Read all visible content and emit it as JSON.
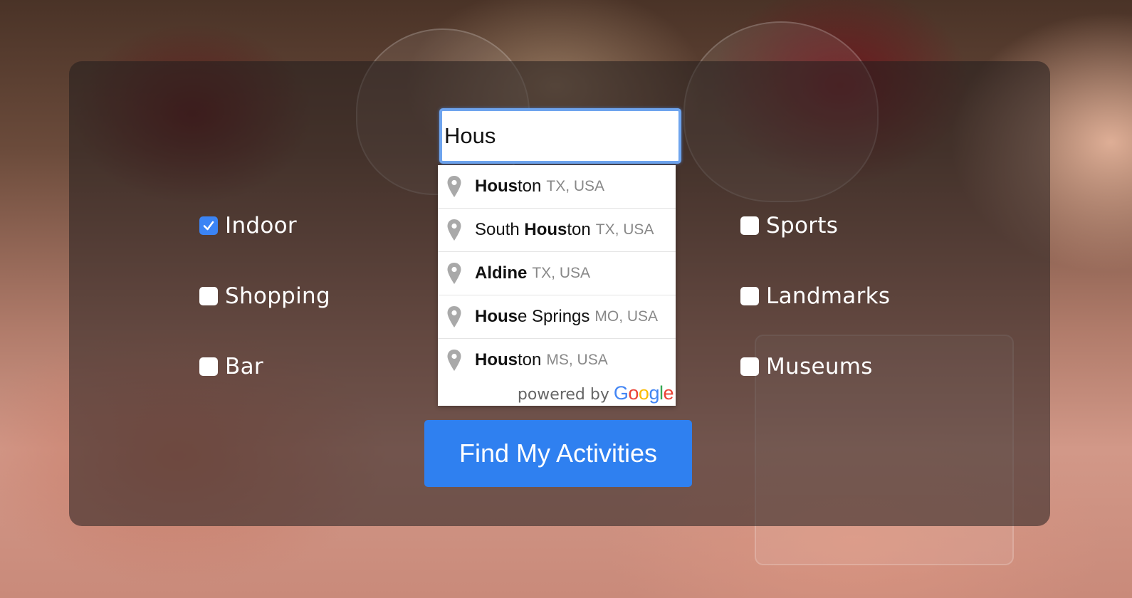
{
  "search": {
    "value": "Hous",
    "suggestions": [
      {
        "bold": "Hous",
        "rest": "ton",
        "secondary": "TX, USA"
      },
      {
        "pre": "South ",
        "bold": "Hous",
        "rest": "ton",
        "secondary": "TX, USA"
      },
      {
        "bold": "Aldine",
        "rest": "",
        "secondary": "TX, USA"
      },
      {
        "bold": "Hous",
        "rest": "e Springs",
        "secondary": "MO, USA"
      },
      {
        "bold": "Hous",
        "rest": "ton",
        "secondary": "MS, USA"
      }
    ],
    "powered_by": "powered by",
    "google": [
      "G",
      "o",
      "o",
      "g",
      "l",
      "e"
    ],
    "google_colors": [
      "#4285F4",
      "#EA4335",
      "#FBBC05",
      "#4285F4",
      "#34A853",
      "#EA4335"
    ]
  },
  "filters": {
    "left": [
      {
        "label": "Indoor",
        "checked": true
      },
      {
        "label": "Shopping",
        "checked": false
      },
      {
        "label": "Bar",
        "checked": false
      }
    ],
    "right": [
      {
        "label": "Sports",
        "checked": false
      },
      {
        "label": "Landmarks",
        "checked": false
      },
      {
        "label": "Museums",
        "checked": false
      }
    ]
  },
  "find_button": "Find My Activities",
  "colors": {
    "accent": "#2f80f0",
    "checkbox_checked": "#3b84f5"
  }
}
